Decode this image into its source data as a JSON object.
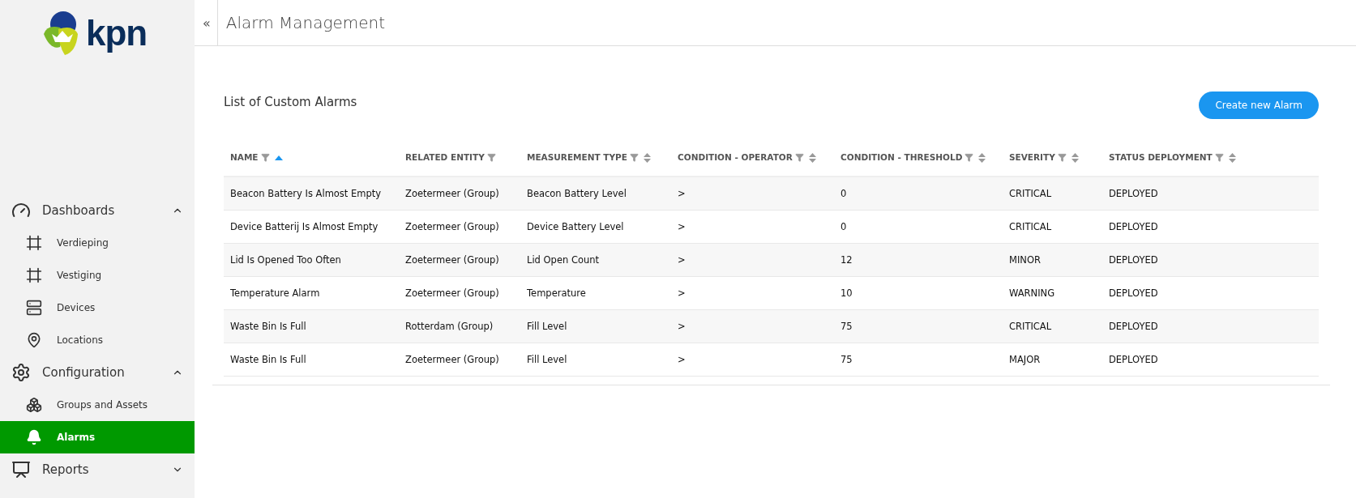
{
  "logo": {
    "text": "kpn"
  },
  "sidebar": {
    "sections": [
      {
        "label": "Dashboards",
        "expanded": true,
        "children": [
          {
            "label": "Verdieping",
            "selected": false
          },
          {
            "label": "Vestiging",
            "selected": false
          },
          {
            "label": "Devices",
            "selected": false
          },
          {
            "label": "Locations",
            "selected": false
          }
        ]
      },
      {
        "label": "Configuration",
        "expanded": true,
        "children": [
          {
            "label": "Groups and Assets",
            "selected": false
          },
          {
            "label": "Alarms",
            "selected": true
          }
        ]
      },
      {
        "label": "Reports",
        "expanded": false
      }
    ]
  },
  "header": {
    "collapse": "«",
    "title": "Alarm Management"
  },
  "card": {
    "title": "List of Custom Alarms",
    "button": "Create new Alarm"
  },
  "table": {
    "columns": [
      {
        "label": "NAME",
        "sortable": true,
        "sorted": true
      },
      {
        "label": "RELATED ENTITY",
        "sortable": false
      },
      {
        "label": "MEASUREMENT TYPE",
        "sortable": true,
        "sorted": false
      },
      {
        "label": "CONDITION - OPERATOR",
        "sortable": true,
        "sorted": false
      },
      {
        "label": "CONDITION - THRESHOLD",
        "sortable": true,
        "sorted": false
      },
      {
        "label": "SEVERITY",
        "sortable": true,
        "sorted": false
      },
      {
        "label": "STATUS DEPLOYMENT",
        "sortable": true,
        "sorted": false
      }
    ],
    "rows": [
      [
        "Beacon Battery Is Almost Empty",
        "Zoetermeer (Group)",
        "Beacon Battery Level",
        ">",
        "0",
        "CRITICAL",
        "DEPLOYED"
      ],
      [
        "Device Batterij Is Almost Empty",
        "Zoetermeer (Group)",
        "Device Battery Level",
        ">",
        "0",
        "CRITICAL",
        "DEPLOYED"
      ],
      [
        "Lid Is Opened Too Often",
        "Zoetermeer (Group)",
        "Lid Open Count",
        ">",
        "12",
        "MINOR",
        "DEPLOYED"
      ],
      [
        "Temperature Alarm",
        "Zoetermeer (Group)",
        "Temperature",
        ">",
        "10",
        "WARNING",
        "DEPLOYED"
      ],
      [
        "Waste Bin Is Full",
        "Rotterdam (Group)",
        "Fill Level",
        ">",
        "75",
        "CRITICAL",
        "DEPLOYED"
      ],
      [
        "Waste Bin Is Full",
        "Zoetermeer (Group)",
        "Fill Level",
        ">",
        "75",
        "MAJOR",
        "DEPLOYED"
      ]
    ]
  }
}
